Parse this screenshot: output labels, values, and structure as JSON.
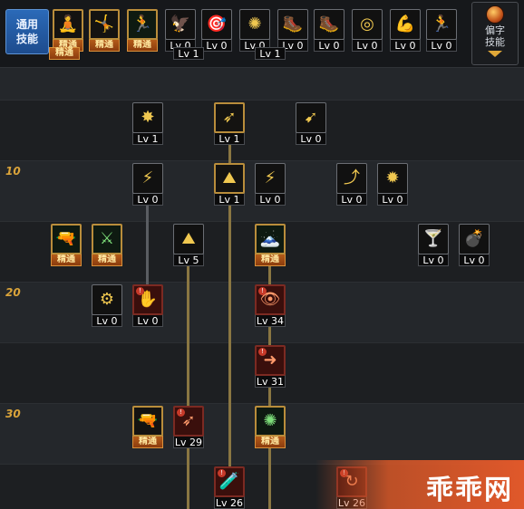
{
  "tabs": {
    "common": "通用\n技能",
    "specific": "偏字\n技能"
  },
  "level_markers": [
    "10",
    "20",
    "30"
  ],
  "top_skills": [
    {
      "glyph": "🧘",
      "badge": "精通",
      "style": "gold"
    },
    {
      "glyph": "🤸",
      "badge": "精通",
      "style": "gold"
    },
    {
      "glyph": "🏃",
      "badge": "精通",
      "style": "green"
    },
    {
      "glyph": "🦅",
      "badge": "Lv 0",
      "style": "plain"
    },
    {
      "glyph": "🎯",
      "badge": "Lv 0",
      "style": "plain"
    },
    {
      "glyph": "✺",
      "badge": "Lv 0",
      "style": "plain"
    },
    {
      "glyph": "🥾",
      "badge": "Lv 0",
      "style": "plain"
    },
    {
      "glyph": "🥾",
      "badge": "Lv 0",
      "style": "plain"
    },
    {
      "glyph": "◎",
      "badge": "Lv 0",
      "style": "plain"
    },
    {
      "glyph": "💪",
      "badge": "Lv 0",
      "style": "plain"
    },
    {
      "glyph": "🏃",
      "badge": "Lv 0",
      "style": "plain"
    }
  ],
  "tree": [
    {
      "name": "r0a",
      "badge": "精通",
      "glyph": "",
      "style": "none"
    },
    {
      "name": "r0b",
      "badge": "Lv 1",
      "glyph": "",
      "style": "none"
    },
    {
      "name": "r0c",
      "badge": "Lv 1",
      "glyph": "",
      "style": "none"
    },
    {
      "name": "r1a",
      "badge": "Lv 1",
      "glyph": "✸",
      "style": "plain"
    },
    {
      "name": "r1b",
      "badge": "Lv 1",
      "glyph": "➶",
      "style": "gold"
    },
    {
      "name": "r1c",
      "badge": "Lv 0",
      "glyph": "➹",
      "style": "plain"
    },
    {
      "name": "r2a",
      "badge": "Lv 0",
      "glyph": "⚡",
      "style": "plain"
    },
    {
      "name": "r2b",
      "badge": "Lv 1",
      "glyph": "⛰",
      "style": "gold"
    },
    {
      "name": "r2c",
      "badge": "Lv 0",
      "glyph": "⚡",
      "style": "plain"
    },
    {
      "name": "r2d",
      "badge": "Lv 0",
      "glyph": "⤴",
      "style": "plain"
    },
    {
      "name": "r2e",
      "badge": "Lv 0",
      "glyph": "✹",
      "style": "plain"
    },
    {
      "name": "r3a",
      "badge": "精通",
      "glyph": "🔫",
      "style": "green"
    },
    {
      "name": "r3b",
      "badge": "精通",
      "glyph": "⚔",
      "style": "green"
    },
    {
      "name": "r3c",
      "badge": "Lv 5",
      "glyph": "⛰",
      "style": "plain"
    },
    {
      "name": "r3d",
      "badge": "精通",
      "glyph": "🗻",
      "style": "green"
    },
    {
      "name": "r3e",
      "badge": "Lv 0",
      "glyph": "🍸",
      "style": "plain"
    },
    {
      "name": "r3f",
      "badge": "Lv 0",
      "glyph": "💣",
      "style": "plain"
    },
    {
      "name": "r4a",
      "badge": "Lv 0",
      "glyph": "⚙",
      "style": "plain"
    },
    {
      "name": "r4b",
      "badge": "Lv 0",
      "glyph": "✋",
      "style": "red"
    },
    {
      "name": "r4c",
      "badge": "Lv 34",
      "glyph": "👁",
      "style": "red"
    },
    {
      "name": "r5a",
      "badge": "Lv 31",
      "glyph": "➜",
      "style": "red"
    },
    {
      "name": "r6a",
      "badge": "精通",
      "glyph": "🔫",
      "style": "gold"
    },
    {
      "name": "r6b",
      "badge": "Lv 29",
      "glyph": "➶",
      "style": "red"
    },
    {
      "name": "r6c",
      "badge": "精通",
      "glyph": "✺",
      "style": "green"
    },
    {
      "name": "r7a",
      "badge": "Lv 26",
      "glyph": "🧪",
      "style": "red"
    },
    {
      "name": "r7b",
      "badge": "Lv 26",
      "glyph": "↻",
      "style": "red"
    }
  ],
  "watermark": "乖乖网"
}
